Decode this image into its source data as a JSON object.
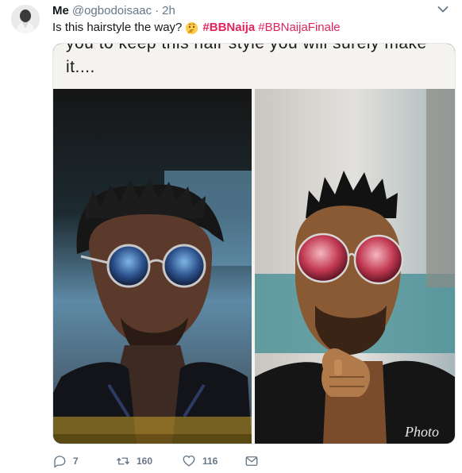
{
  "tweet": {
    "name": "Me",
    "handle": "@ogbodoisaac",
    "separator": "·",
    "time": "2h",
    "text": "Is this hairstyle the way?",
    "emoji": "thinking-face-emoji",
    "hashtags": [
      "#BBNaija",
      "#BBNaijaFinale"
    ],
    "image_caption_line1": "you to keep this hair style you will surely make",
    "image_caption_line2": "it....",
    "image_watermark": "Photo",
    "counts": {
      "replies": "7",
      "retweets": "160",
      "likes": "116"
    }
  },
  "icons": {
    "more": "chevron-down-icon",
    "reply": "reply-icon",
    "retweet": "retweet-icon",
    "like": "heart-icon",
    "dm": "envelope-icon"
  },
  "colors": {
    "hashtag": "#e0245e",
    "secondary_text": "#657786",
    "border": "#e1e8ed"
  }
}
